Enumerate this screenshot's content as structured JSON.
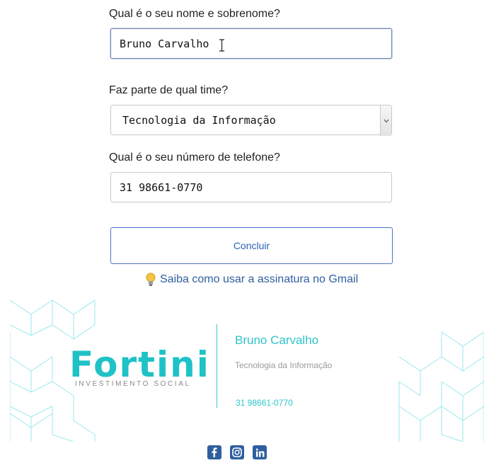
{
  "form": {
    "name_label": "Qual é o seu nome e sobrenome?",
    "name_value": "Bruno Carvalho",
    "team_label": "Faz parte de qual time?",
    "team_value": "Tecnologia da Informação",
    "phone_label": "Qual é o seu número de telefone?",
    "phone_value": "31 98661-0770",
    "submit_label": "Concluir",
    "help_link": "Saiba como usar a assinatura no Gmail"
  },
  "signature": {
    "logo_text": "Fortini",
    "logo_subtitle": "INVESTIMENTO SOCIAL",
    "name": "Bruno Carvalho",
    "team": "Tecnologia da Informação",
    "phone": "31 98661-0770",
    "social_icons": [
      "facebook-icon",
      "instagram-icon",
      "linkedin-icon"
    ]
  },
  "colors": {
    "accent_teal": "#1fc2c7",
    "link_blue": "#2f5f9e",
    "button_blue": "#4d74c4"
  }
}
